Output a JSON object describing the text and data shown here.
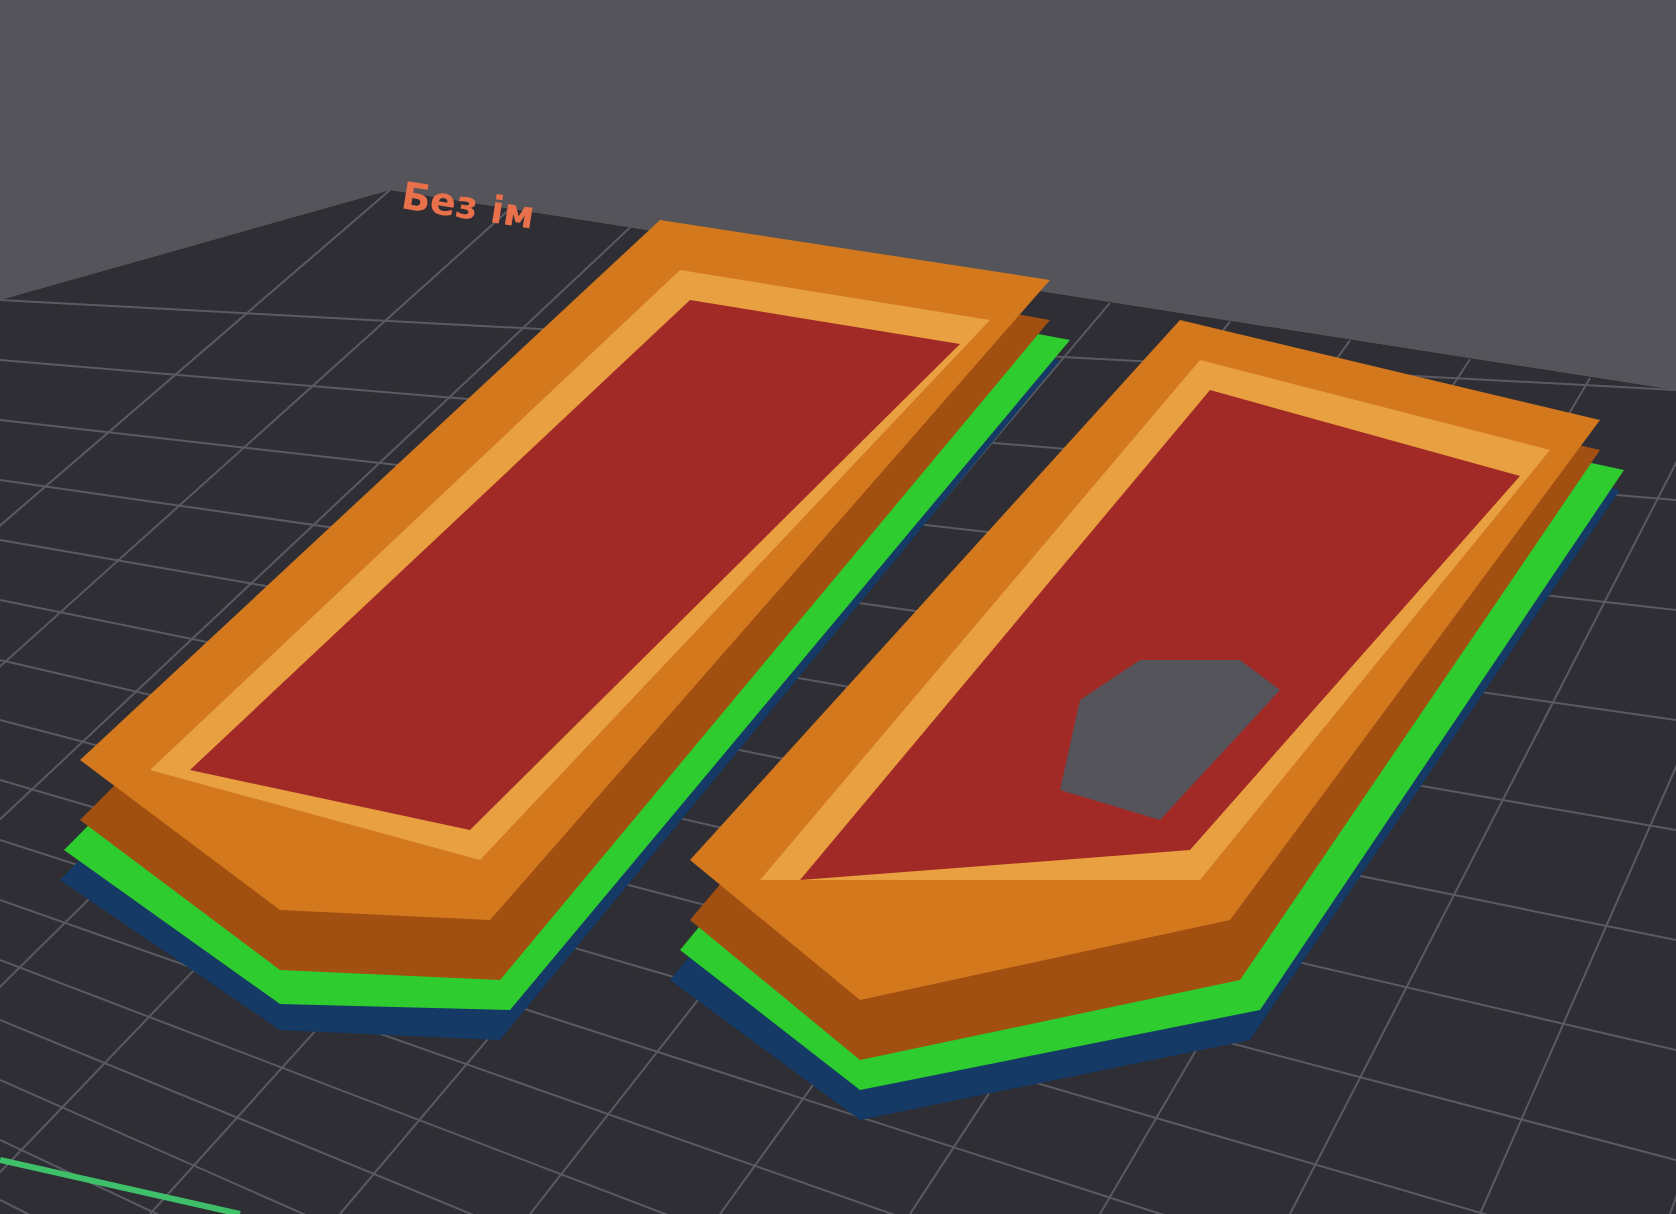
{
  "viewport": {
    "bed_label": "Без ім"
  }
}
